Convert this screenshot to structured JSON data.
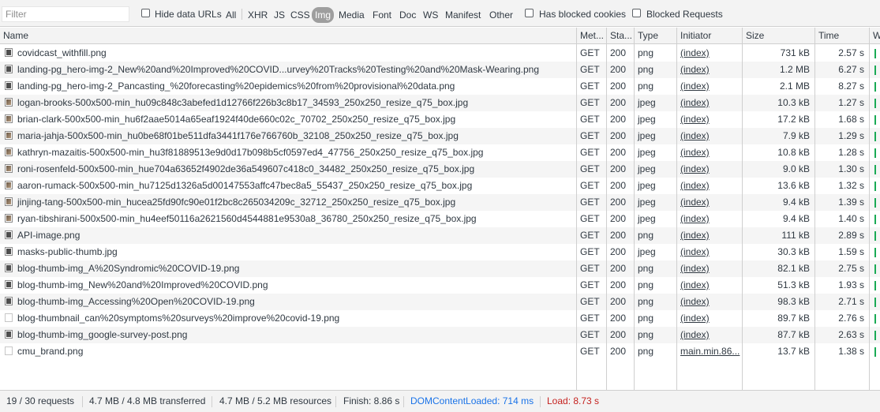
{
  "filter": {
    "placeholder": "Filter"
  },
  "toolbar": {
    "hide_data_urls": "Hide data URLs",
    "types": [
      "All",
      "XHR",
      "JS",
      "CSS",
      "Img",
      "Media",
      "Font",
      "Doc",
      "WS",
      "Manifest",
      "Other"
    ],
    "active_type": "Img",
    "has_blocked_cookies": "Has blocked cookies",
    "blocked_requests": "Blocked Requests"
  },
  "columns": {
    "name": "Name",
    "method": "Met...",
    "status": "Sta...",
    "type": "Type",
    "initiator": "Initiator",
    "size": "Size",
    "time": "Time",
    "waterfall": "W"
  },
  "rows": [
    {
      "name": "covidcast_withfill.png",
      "method": "GET",
      "status": "200",
      "type": "png",
      "initiator": "(index)",
      "size": "731 kB",
      "time": "2.57 s",
      "icon": "dark"
    },
    {
      "name": "landing-pg_hero-img-2_New%20and%20Improved%20COVID...urvey%20Tracks%20Testing%20and%20Mask-Wearing.png",
      "method": "GET",
      "status": "200",
      "type": "png",
      "initiator": "(index)",
      "size": "1.2 MB",
      "time": "6.27 s",
      "icon": "dark"
    },
    {
      "name": "landing-pg_hero-img-2_Pancasting_%20forecasting%20epidemics%20from%20provisional%20data.png",
      "method": "GET",
      "status": "200",
      "type": "png",
      "initiator": "(index)",
      "size": "2.1 MB",
      "time": "8.27 s",
      "icon": "dark"
    },
    {
      "name": "logan-brooks-500x500-min_hu09c848c3abefed1d12766f226b3c8b17_34593_250x250_resize_q75_box.jpg",
      "method": "GET",
      "status": "200",
      "type": "jpeg",
      "initiator": "(index)",
      "size": "10.3 kB",
      "time": "1.27 s",
      "icon": "photo"
    },
    {
      "name": "brian-clark-500x500-min_hu6f2aae5014a65eaf1924f40de660c02c_70702_250x250_resize_q75_box.jpg",
      "method": "GET",
      "status": "200",
      "type": "jpeg",
      "initiator": "(index)",
      "size": "17.2 kB",
      "time": "1.68 s",
      "icon": "photo"
    },
    {
      "name": "maria-jahja-500x500-min_hu0be68f01be511dfa3441f176e766760b_32108_250x250_resize_q75_box.jpg",
      "method": "GET",
      "status": "200",
      "type": "jpeg",
      "initiator": "(index)",
      "size": "7.9 kB",
      "time": "1.29 s",
      "icon": "photo"
    },
    {
      "name": "kathryn-mazaitis-500x500-min_hu3f81889513e9d0d17b098b5cf0597ed4_47756_250x250_resize_q75_box.jpg",
      "method": "GET",
      "status": "200",
      "type": "jpeg",
      "initiator": "(index)",
      "size": "10.8 kB",
      "time": "1.28 s",
      "icon": "photo"
    },
    {
      "name": "roni-rosenfeld-500x500-min_hue704a63652f4902de36a549607c418c0_34482_250x250_resize_q75_box.jpg",
      "method": "GET",
      "status": "200",
      "type": "jpeg",
      "initiator": "(index)",
      "size": "9.0 kB",
      "time": "1.30 s",
      "icon": "photo"
    },
    {
      "name": "aaron-rumack-500x500-min_hu7125d1326a5d00147553affc47bec8a5_55437_250x250_resize_q75_box.jpg",
      "method": "GET",
      "status": "200",
      "type": "jpeg",
      "initiator": "(index)",
      "size": "13.6 kB",
      "time": "1.32 s",
      "icon": "photo"
    },
    {
      "name": "jinjing-tang-500x500-min_hucea25fd90fc90e01f2bc8c265034209c_32712_250x250_resize_q75_box.jpg",
      "method": "GET",
      "status": "200",
      "type": "jpeg",
      "initiator": "(index)",
      "size": "9.4 kB",
      "time": "1.39 s",
      "icon": "photo"
    },
    {
      "name": "ryan-tibshirani-500x500-min_hu4eef50116a2621560d4544881e9530a8_36780_250x250_resize_q75_box.jpg",
      "method": "GET",
      "status": "200",
      "type": "jpeg",
      "initiator": "(index)",
      "size": "9.4 kB",
      "time": "1.40 s",
      "icon": "photo"
    },
    {
      "name": "API-image.png",
      "method": "GET",
      "status": "200",
      "type": "png",
      "initiator": "(index)",
      "size": "111 kB",
      "time": "2.89 s",
      "icon": "dark"
    },
    {
      "name": "masks-public-thumb.jpg",
      "method": "GET",
      "status": "200",
      "type": "jpeg",
      "initiator": "(index)",
      "size": "30.3 kB",
      "time": "1.59 s",
      "icon": "dark"
    },
    {
      "name": "blog-thumb-img_A%20Syndromic%20COVID-19.png",
      "method": "GET",
      "status": "200",
      "type": "png",
      "initiator": "(index)",
      "size": "82.1 kB",
      "time": "2.75 s",
      "icon": "dark"
    },
    {
      "name": "blog-thumb-img_New%20and%20Improved%20COVID.png",
      "method": "GET",
      "status": "200",
      "type": "png",
      "initiator": "(index)",
      "size": "51.3 kB",
      "time": "1.93 s",
      "icon": "dark"
    },
    {
      "name": "blog-thumb-img_Accessing%20Open%20COVID-19.png",
      "method": "GET",
      "status": "200",
      "type": "png",
      "initiator": "(index)",
      "size": "98.3 kB",
      "time": "2.71 s",
      "icon": "dark"
    },
    {
      "name": "blog-thumbnail_can%20symptoms%20surveys%20improve%20covid-19.png",
      "method": "GET",
      "status": "200",
      "type": "png",
      "initiator": "(index)",
      "size": "89.7 kB",
      "time": "2.76 s",
      "icon": "blank"
    },
    {
      "name": "blog-thumb-img_google-survey-post.png",
      "method": "GET",
      "status": "200",
      "type": "png",
      "initiator": "(index)",
      "size": "87.7 kB",
      "time": "2.63 s",
      "icon": "dark"
    },
    {
      "name": "cmu_brand.png",
      "method": "GET",
      "status": "200",
      "type": "png",
      "initiator": "main.min.86...",
      "size": "13.7 kB",
      "time": "1.38 s",
      "icon": "blank"
    }
  ],
  "status": {
    "requests": "19 / 30 requests",
    "transferred": "4.7 MB / 4.8 MB transferred",
    "resources": "4.7 MB / 5.2 MB resources",
    "finish": "Finish: 8.86 s",
    "dom_content_loaded": "DOMContentLoaded: 714 ms",
    "load": "Load: 8.73 s"
  },
  "colors": {
    "dom_content_loaded": "#1a73e8",
    "load": "#c5221f",
    "waterfall": "#1aaa55",
    "active_filter": "#9e9e9e"
  }
}
